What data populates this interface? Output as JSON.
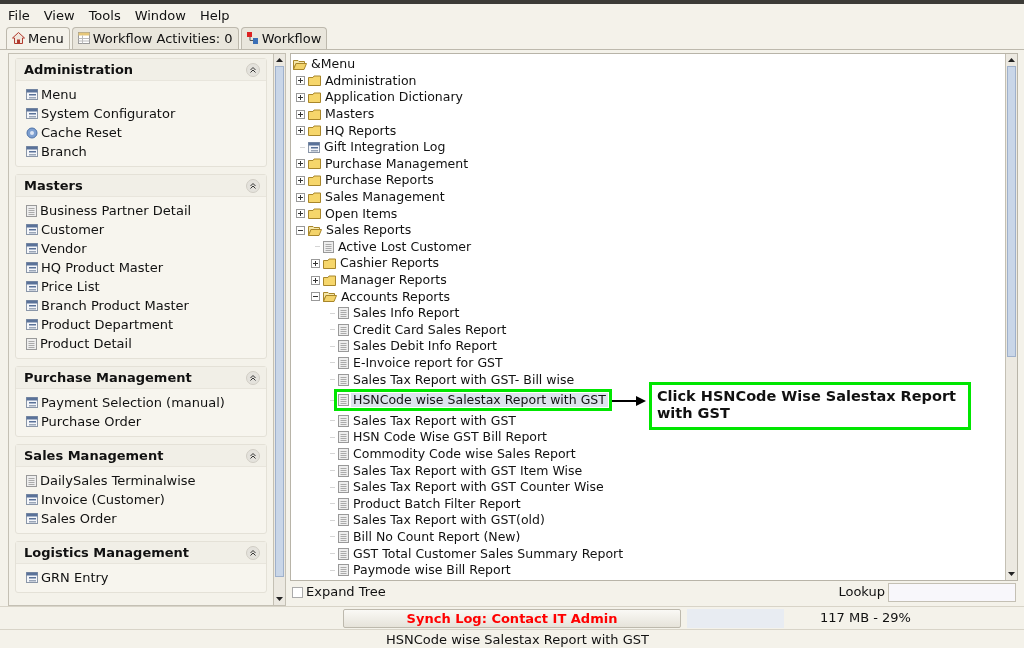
{
  "menu_bar": [
    "File",
    "View",
    "Tools",
    "Window",
    "Help"
  ],
  "tabs": [
    {
      "label": "Menu",
      "kind": "home",
      "selected": true
    },
    {
      "label": "Workflow Activities: 0",
      "kind": "table",
      "selected": false
    },
    {
      "label": "Workflow",
      "kind": "workflow",
      "selected": false
    }
  ],
  "sidebar": {
    "sections": [
      {
        "title": "Administration",
        "items": [
          {
            "label": "Menu",
            "kind": "window"
          },
          {
            "label": "System Configurator",
            "kind": "window"
          },
          {
            "label": "Cache Reset",
            "kind": "process"
          },
          {
            "label": "Branch",
            "kind": "window"
          }
        ]
      },
      {
        "title": "Masters",
        "items": [
          {
            "label": "Business Partner Detail",
            "kind": "report"
          },
          {
            "label": "Customer",
            "kind": "window"
          },
          {
            "label": "Vendor",
            "kind": "window"
          },
          {
            "label": "HQ Product Master",
            "kind": "window"
          },
          {
            "label": "Price List",
            "kind": "window"
          },
          {
            "label": "Branch Product Master",
            "kind": "window"
          },
          {
            "label": "Product Department",
            "kind": "window"
          },
          {
            "label": "Product Detail",
            "kind": "report"
          }
        ]
      },
      {
        "title": "Purchase Management",
        "items": [
          {
            "label": "Payment Selection (manual)",
            "kind": "window"
          },
          {
            "label": "Purchase Order",
            "kind": "window"
          }
        ]
      },
      {
        "title": "Sales Management",
        "items": [
          {
            "label": "DailySales Terminalwise",
            "kind": "report"
          },
          {
            "label": "Invoice (Customer)",
            "kind": "window"
          },
          {
            "label": "Sales Order",
            "kind": "window"
          }
        ]
      },
      {
        "title": "Logistics Management",
        "items": [
          {
            "label": "GRN Entry",
            "kind": "window"
          }
        ]
      }
    ]
  },
  "tree": {
    "label": "&Menu",
    "kind": "folder",
    "expanded": true,
    "selected": false,
    "children": [
      {
        "label": "Administration",
        "kind": "folder",
        "expanded": false,
        "selected": false
      },
      {
        "label": "Application Dictionary",
        "kind": "folder",
        "expanded": false,
        "selected": false
      },
      {
        "label": "Masters",
        "kind": "folder",
        "expanded": false,
        "selected": false
      },
      {
        "label": "HQ Reports",
        "kind": "folder",
        "expanded": false,
        "selected": false
      },
      {
        "label": "Gift Integration Log",
        "kind": "window",
        "selected": false
      },
      {
        "label": "Purchase Management",
        "kind": "folder",
        "expanded": false,
        "selected": false
      },
      {
        "label": "Purchase Reports",
        "kind": "folder",
        "expanded": false,
        "selected": false
      },
      {
        "label": "Sales Management",
        "kind": "folder",
        "expanded": false,
        "selected": false
      },
      {
        "label": "Open Items",
        "kind": "folder",
        "expanded": false,
        "selected": false
      },
      {
        "label": "Sales Reports",
        "kind": "folder",
        "expanded": true,
        "selected": false,
        "children": [
          {
            "label": "Active Lost Customer",
            "kind": "report",
            "selected": false
          },
          {
            "label": "Cashier Reports",
            "kind": "folder",
            "expanded": false,
            "selected": false
          },
          {
            "label": "Manager Reports",
            "kind": "folder",
            "expanded": false,
            "selected": false
          },
          {
            "label": "Accounts Reports",
            "kind": "folder",
            "expanded": true,
            "selected": false,
            "children": [
              {
                "label": "Sales Info Report",
                "kind": "report",
                "selected": false
              },
              {
                "label": "Credit Card Sales Report",
                "kind": "report",
                "selected": false
              },
              {
                "label": "Sales Debit Info Report",
                "kind": "report",
                "selected": false
              },
              {
                "label": "E-Invoice report for GST",
                "kind": "report",
                "selected": false
              },
              {
                "label": "Sales Tax Report with GST- Bill wise",
                "kind": "report",
                "selected": false
              },
              {
                "label": "HSNCode wise Salestax Report with GST",
                "kind": "report",
                "selected": true
              },
              {
                "label": "Sales Tax Report with GST",
                "kind": "report",
                "selected": false
              },
              {
                "label": "HSN Code Wise GST Bill Report",
                "kind": "report",
                "selected": false
              },
              {
                "label": "Commodity Code wise Sales Report",
                "kind": "report",
                "selected": false
              },
              {
                "label": "Sales Tax Report with GST Item Wise",
                "kind": "report",
                "selected": false
              },
              {
                "label": "Sales Tax Report with GST Counter Wise",
                "kind": "report",
                "selected": false
              },
              {
                "label": "Product Batch Filter Report",
                "kind": "report",
                "selected": false
              },
              {
                "label": "Sales Tax Report with GST(old)",
                "kind": "report",
                "selected": false
              },
              {
                "label": "Bill No Count Report (New)",
                "kind": "report",
                "selected": false
              },
              {
                "label": "GST Total Customer Sales Summary Report",
                "kind": "report",
                "selected": false
              },
              {
                "label": "Paymode wise Bill Report",
                "kind": "report",
                "selected": false
              }
            ]
          }
        ]
      }
    ]
  },
  "annotation": {
    "text": "Click HSNCode Wise Salestax Report with GST"
  },
  "expand_tree": {
    "label": "Expand Tree",
    "checked": false
  },
  "lookup": {
    "label": "Lookup"
  },
  "status_bar": {
    "sync_button": "Synch Log: Contact IT Admin",
    "memory": "117 MB - 29%"
  },
  "status_line": "HSNCode wise Salestax Report with GST"
}
